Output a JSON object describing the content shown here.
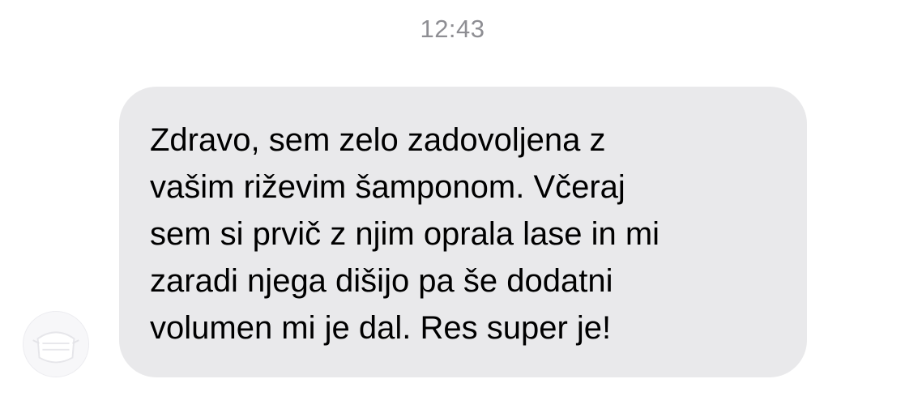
{
  "conversation": {
    "timestamp": "12:43",
    "messages": [
      {
        "direction": "incoming",
        "avatar_icon": "person-avatar-icon",
        "text": "Zdravo, sem zelo zadovoljena z\nvašim riževim šamponom. Včeraj\nsem si prvič z njim oprala lase in mi\nzaradi njega dišijo pa še dodatni\nvolumen mi je dal. Res super je!"
      }
    ]
  },
  "colors": {
    "background": "#ffffff",
    "incoming_bubble": "#e9e9eb",
    "timestamp_text": "#8e8e93",
    "message_text": "#000000"
  }
}
